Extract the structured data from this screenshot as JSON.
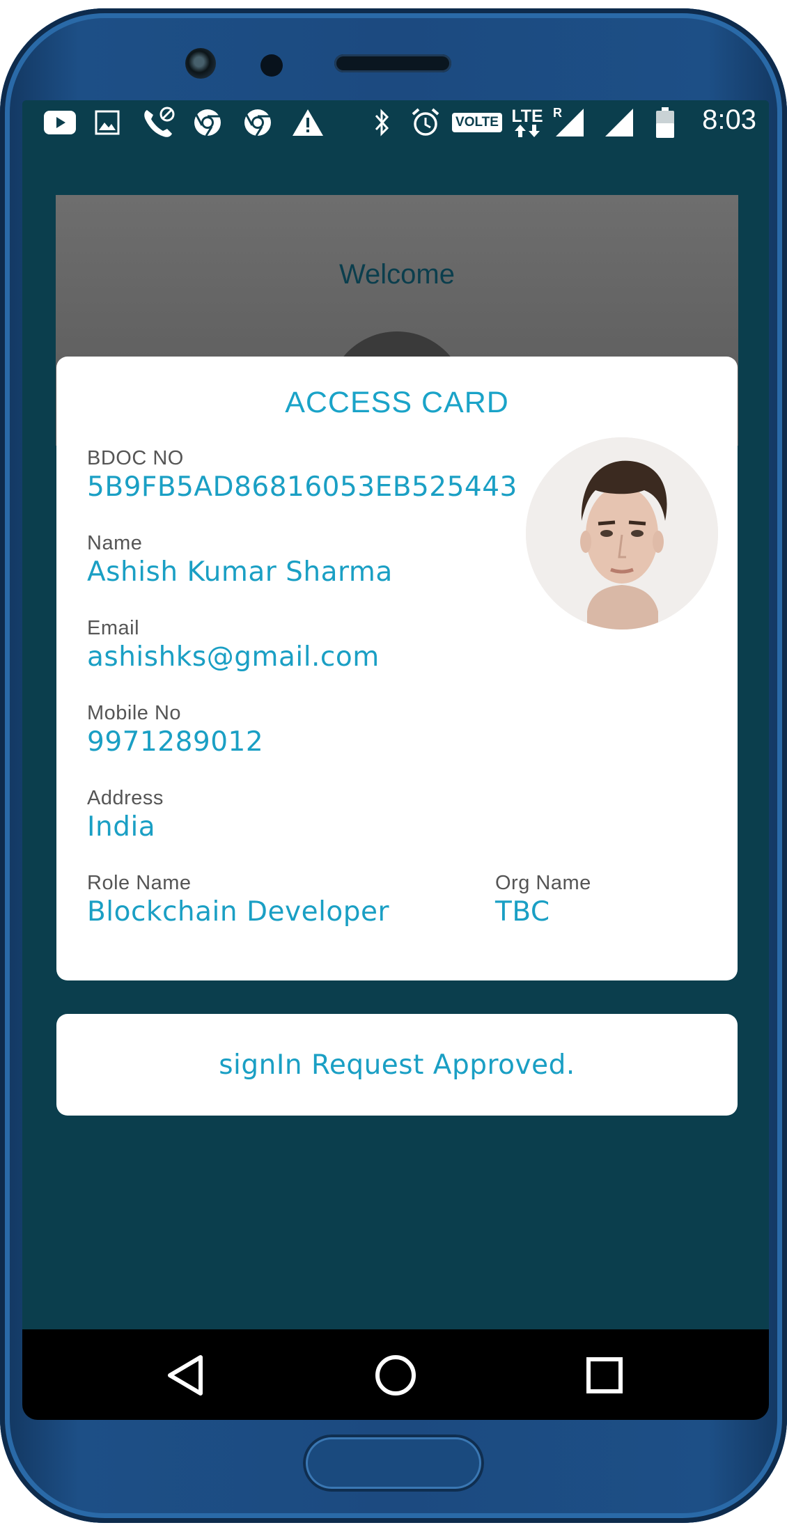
{
  "status_bar": {
    "time": "8:03",
    "volte_label": "VOLTE",
    "lte_label": "LTE",
    "roaming_label": "R",
    "icons": [
      "youtube-icon",
      "image-icon",
      "call-blocked-icon",
      "chrome-icon",
      "chrome-icon",
      "warning-icon",
      "bluetooth-icon",
      "alarm-icon",
      "volte-icon",
      "lte-icon",
      "signal-icon",
      "signal-icon",
      "battery-icon"
    ]
  },
  "welcome": {
    "title": "Welcome"
  },
  "access_card": {
    "title": "ACCESS CARD",
    "fields": {
      "bdoc": {
        "label": "BDOC NO",
        "value": "5B9FB5AD86816053EB525443"
      },
      "name": {
        "label": "Name",
        "value": "Ashish Kumar Sharma"
      },
      "email": {
        "label": "Email",
        "value": "ashishks@gmail.com"
      },
      "mobile": {
        "label": "Mobile No",
        "value": "9971289012"
      },
      "address": {
        "label": "Address",
        "value": "India"
      },
      "role": {
        "label": "Role Name",
        "value": "Blockchain Developer"
      },
      "org": {
        "label": "Org Name",
        "value": "TBC"
      }
    }
  },
  "approval": {
    "message": "signIn Request Approved."
  },
  "nav": {
    "icons": [
      "back-icon",
      "home-icon",
      "recents-icon"
    ]
  },
  "colors": {
    "screen_bg": "#0b3e4d",
    "accent": "#1a9fc4",
    "card_bg": "#ffffff",
    "frame": "#1c4a80"
  }
}
